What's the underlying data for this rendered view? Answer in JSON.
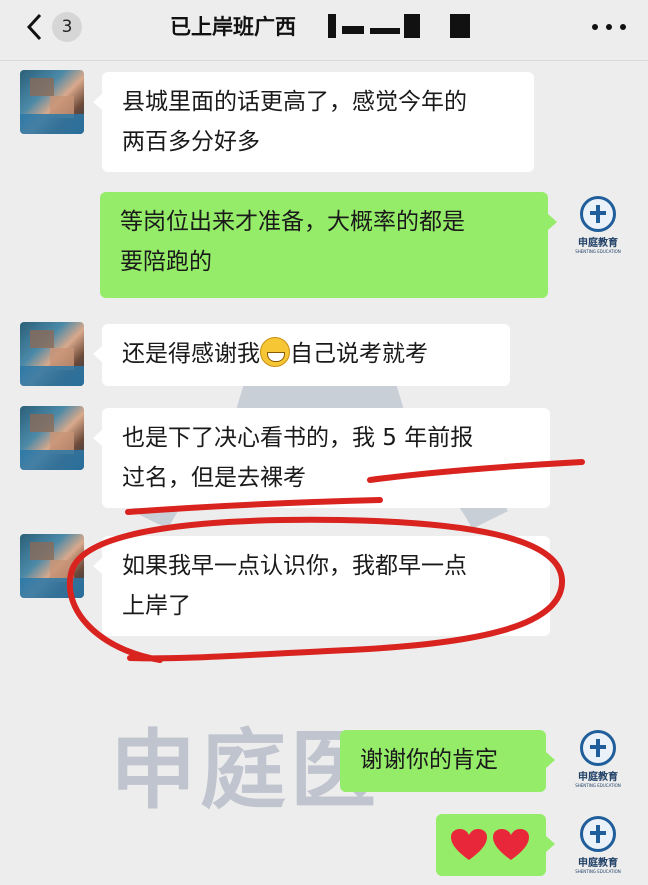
{
  "header": {
    "back_count": "3",
    "title": "已上岸班广西"
  },
  "messages": [
    {
      "side": "in",
      "text_line1": "县城里面的话更高了，感觉今年的",
      "text_line2": "两百多分好多"
    },
    {
      "side": "out",
      "text_line1": "等岗位出来才准备，大概率的都是",
      "text_line2": "要陪跑的"
    },
    {
      "side": "in",
      "text_before": "还是得感谢我",
      "emoji": "grinning-face",
      "text_after": "自己说考就考"
    },
    {
      "side": "in",
      "text_line1": "也是下了决心看书的，我 5 年前报",
      "text_line2": "过名，但是去裸考"
    },
    {
      "side": "in",
      "text_line1": "如果我早一点认识你，我都早一点",
      "text_line2": "上岸了"
    },
    {
      "side": "out",
      "text_line1": "谢谢你的肯定"
    },
    {
      "side": "out",
      "emoji": "two-red-hearts"
    }
  ],
  "brand_avatar": {
    "name": "申庭教育",
    "sub": "SHENTING EDUCATION"
  },
  "watermark": {
    "text": "申庭医"
  },
  "colors": {
    "background": "#ededed",
    "bubble_in": "#ffffff",
    "bubble_out": "#95ec69",
    "annotation": "#d9231f"
  }
}
